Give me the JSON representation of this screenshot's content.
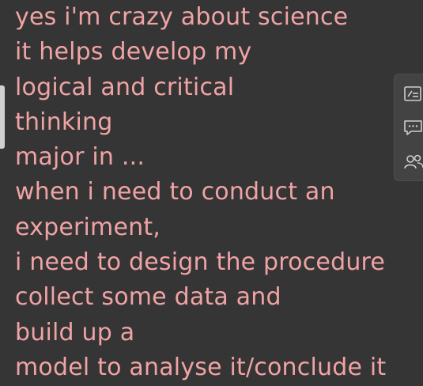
{
  "text_lines": [
    "yes i'm crazy about science",
    "it helps develop my",
    "logical and critical",
    "thinking",
    "major in ...",
    "when i need to conduct an",
    "experiment,",
    "i need to design the procedure",
    "collect some data and",
    "build up a",
    "model to analyse it/conclude it"
  ],
  "side_toolbar": {
    "icons": [
      "note-edit-icon",
      "chat-bubble-icon",
      "people-icon"
    ]
  },
  "colors": {
    "background": "#353535",
    "text": "#f0a3a5",
    "toolbar_bg": "#434343",
    "icon": "#cfcfcf"
  }
}
